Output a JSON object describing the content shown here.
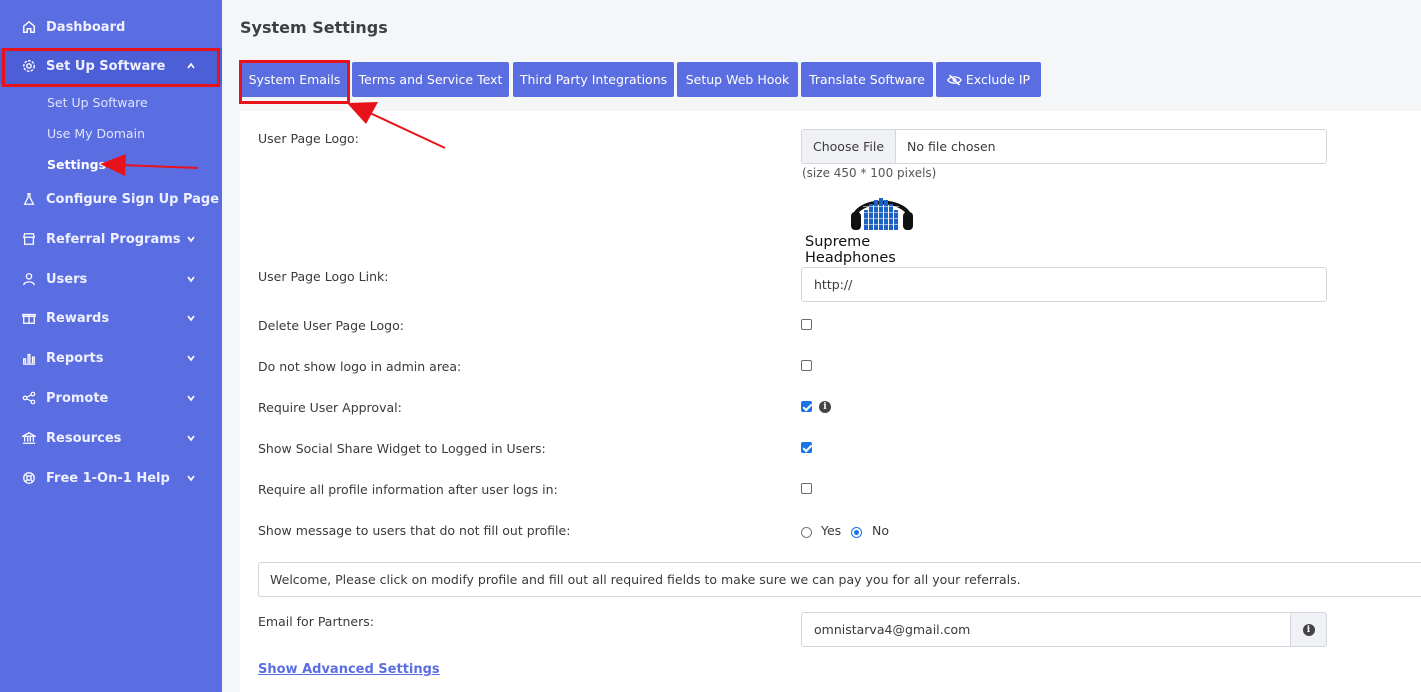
{
  "sidebar": {
    "items": [
      {
        "label": "Dashboard",
        "icon": "home-icon"
      },
      {
        "label": "Set Up Software",
        "icon": "gear-icon"
      },
      {
        "label": "Configure Sign Up Page",
        "icon": "flask-icon"
      },
      {
        "label": "Referral Programs",
        "icon": "store-icon"
      },
      {
        "label": "Users",
        "icon": "user-icon"
      },
      {
        "label": "Rewards",
        "icon": "gift-icon"
      },
      {
        "label": "Reports",
        "icon": "chart-icon"
      },
      {
        "label": "Promote",
        "icon": "share-icon"
      },
      {
        "label": "Resources",
        "icon": "bank-icon"
      },
      {
        "label": "Free 1-On-1 Help",
        "icon": "lifering-icon"
      }
    ],
    "sub_items": [
      "Set Up Software",
      "Use My Domain",
      "Settings"
    ]
  },
  "header": {
    "title": "System Settings"
  },
  "tabs": [
    {
      "label": "System Emails"
    },
    {
      "label": "Terms and Service Text"
    },
    {
      "label": "Third Party Integrations"
    },
    {
      "label": "Setup Web Hook"
    },
    {
      "label": "Translate Software"
    },
    {
      "label": "Exclude IP",
      "icon": "eye-slash-icon"
    }
  ],
  "form": {
    "logo_label": "User Page Logo:",
    "file_button": "Choose File",
    "file_status": "No file chosen",
    "size_hint": "(size 450 * 100 pixels)",
    "logo_brand": "Supreme Headphones",
    "logo_link_label": "User Page Logo Link:",
    "logo_link_value": "http://",
    "delete_logo_label": "Delete User Page Logo:",
    "delete_logo_checked": false,
    "hide_logo_admin_label": "Do not show logo in admin area:",
    "hide_logo_admin_checked": false,
    "require_approval_label": "Require User Approval:",
    "require_approval_checked": true,
    "social_widget_label": "Show Social Share Widget to Logged in Users:",
    "social_widget_checked": true,
    "require_profile_label": "Require all profile information after user logs in:",
    "require_profile_checked": false,
    "show_message_label": "Show message to users that do not fill out profile:",
    "radio_yes": "Yes",
    "radio_no": "No",
    "radio_selected": "No",
    "message_value": "Welcome, Please click on modify profile and fill out all required fields to make sure we can pay you for all your referrals.",
    "email_label": "Email for Partners:",
    "email_value": "omnistarva4@gmail.com",
    "advanced_link": "Show Advanced Settings"
  },
  "colors": {
    "sidebar_bg": "#5b6ee1",
    "accent": "#5b6ee1",
    "highlight": "#e8121b",
    "checkbox_checked": "#1a73e8"
  }
}
